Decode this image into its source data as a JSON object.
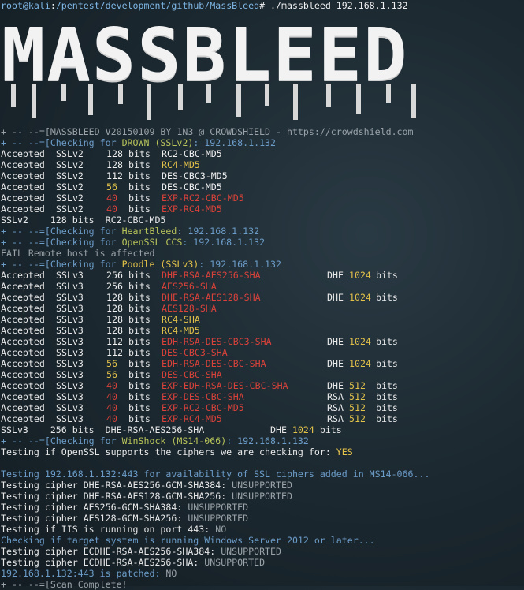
{
  "prompt": {
    "user_host": "root@kali",
    "path": "/pentest/development/github/MassBleed",
    "command": "# ./massbleed 192.168.1.132"
  },
  "banner_text": "MASSBLEED",
  "header_line": "+ -- --=[MASSBLEED V20150109 BY 1N3 @ CROWDSHIELD - https://crowdshield.com",
  "drown": {
    "check_line_prefix": "+ -- --=[Checking for ",
    "check_name": "DROWN (SSLv2)",
    "check_suffix": ": 192.168.1.132",
    "rows": [
      {
        "status": "Accepted",
        "proto": "SSLv2",
        "bits": "128",
        "cipher": "RC2-CBC-MD5",
        "bits_color": "white",
        "cipher_color": "white"
      },
      {
        "status": "Accepted",
        "proto": "SSLv2",
        "bits": "128",
        "cipher": "RC4-MD5",
        "bits_color": "white",
        "cipher_color": "yellow"
      },
      {
        "status": "Accepted",
        "proto": "SSLv2",
        "bits": "112",
        "cipher": "DES-CBC3-MD5",
        "bits_color": "white",
        "cipher_color": "white"
      },
      {
        "status": "Accepted",
        "proto": "SSLv2",
        "bits": "56",
        "cipher": "DES-CBC-MD5",
        "bits_color": "yellow",
        "cipher_color": "white"
      },
      {
        "status": "Accepted",
        "proto": "SSLv2",
        "bits": "40",
        "cipher": "EXP-RC2-CBC-MD5",
        "bits_color": "red",
        "cipher_color": "red"
      },
      {
        "status": "Accepted",
        "proto": "SSLv2",
        "bits": "40",
        "cipher": "EXP-RC4-MD5",
        "bits_color": "red",
        "cipher_color": "red"
      }
    ],
    "summary": "SSLv2    128 bits  RC2-CBC-MD5"
  },
  "heartbleed_line": {
    "prefix": "+ -- --=[Checking for ",
    "name": "HeartBleed",
    "suffix": ": 192.168.1.132"
  },
  "ccs_line": {
    "prefix": "+ -- --=[Checking for ",
    "name": "OpenSSL CCS",
    "suffix": ": 192.168.1.132"
  },
  "fail_line": "FAIL Remote host is affected",
  "poodle": {
    "prefix": "+ -- --=[Checking for ",
    "name": "Poodle (SSLv3)",
    "suffix": ": 192.168.1.132",
    "rows": [
      {
        "status": "Accepted",
        "proto": "SSLv3",
        "bits": "256",
        "cipher": "DHE-RSA-AES256-SHA",
        "bits_color": "white",
        "cipher_color": "red",
        "kx": "DHE",
        "kx_bits": "1024"
      },
      {
        "status": "Accepted",
        "proto": "SSLv3",
        "bits": "256",
        "cipher": "AES256-SHA",
        "bits_color": "white",
        "cipher_color": "red",
        "kx": "",
        "kx_bits": ""
      },
      {
        "status": "Accepted",
        "proto": "SSLv3",
        "bits": "128",
        "cipher": "DHE-RSA-AES128-SHA",
        "bits_color": "white",
        "cipher_color": "red",
        "kx": "DHE",
        "kx_bits": "1024"
      },
      {
        "status": "Accepted",
        "proto": "SSLv3",
        "bits": "128",
        "cipher": "AES128-SHA",
        "bits_color": "white",
        "cipher_color": "red",
        "kx": "",
        "kx_bits": ""
      },
      {
        "status": "Accepted",
        "proto": "SSLv3",
        "bits": "128",
        "cipher": "RC4-SHA",
        "bits_color": "white",
        "cipher_color": "yellow",
        "kx": "",
        "kx_bits": ""
      },
      {
        "status": "Accepted",
        "proto": "SSLv3",
        "bits": "128",
        "cipher": "RC4-MD5",
        "bits_color": "white",
        "cipher_color": "yellow",
        "kx": "",
        "kx_bits": ""
      },
      {
        "status": "Accepted",
        "proto": "SSLv3",
        "bits": "112",
        "cipher": "EDH-RSA-DES-CBC3-SHA",
        "bits_color": "white",
        "cipher_color": "red",
        "kx": "DHE",
        "kx_bits": "1024"
      },
      {
        "status": "Accepted",
        "proto": "SSLv3",
        "bits": "112",
        "cipher": "DES-CBC3-SHA",
        "bits_color": "white",
        "cipher_color": "red",
        "kx": "",
        "kx_bits": ""
      },
      {
        "status": "Accepted",
        "proto": "SSLv3",
        "bits": "56",
        "cipher": "EDH-RSA-DES-CBC-SHA",
        "bits_color": "yellow",
        "cipher_color": "red",
        "kx": "DHE",
        "kx_bits": "1024"
      },
      {
        "status": "Accepted",
        "proto": "SSLv3",
        "bits": "56",
        "cipher": "DES-CBC-SHA",
        "bits_color": "yellow",
        "cipher_color": "red",
        "kx": "",
        "kx_bits": ""
      },
      {
        "status": "Accepted",
        "proto": "SSLv3",
        "bits": "40",
        "cipher": "EXP-EDH-RSA-DES-CBC-SHA",
        "bits_color": "red",
        "cipher_color": "red",
        "kx": "DHE",
        "kx_bits": "512"
      },
      {
        "status": "Accepted",
        "proto": "SSLv3",
        "bits": "40",
        "cipher": "EXP-DES-CBC-SHA",
        "bits_color": "red",
        "cipher_color": "red",
        "kx": "RSA",
        "kx_bits": "512"
      },
      {
        "status": "Accepted",
        "proto": "SSLv3",
        "bits": "40",
        "cipher": "EXP-RC2-CBC-MD5",
        "bits_color": "red",
        "cipher_color": "red",
        "kx": "RSA",
        "kx_bits": "512"
      },
      {
        "status": "Accepted",
        "proto": "SSLv3",
        "bits": "40",
        "cipher": "EXP-RC4-MD5",
        "bits_color": "red",
        "cipher_color": "red",
        "kx": "RSA",
        "kx_bits": "512"
      }
    ],
    "summary_left": "SSLv3    256 bits  DHE-RSA-AES256-SHA",
    "summary_kx": "DHE",
    "summary_kx_bits": "1024",
    "summary_bits_word": "bits"
  },
  "winshock": {
    "prefix": "+ -- --=[Checking for ",
    "name": "WinShock (MS14-066)",
    "suffix": ": 192.168.1.132",
    "testing_openssl": "Testing if OpenSSL supports the ciphers we are checking for: ",
    "testing_openssl_result": "YES",
    "availability_line": "Testing 192.168.1.132:443 for availability of SSL ciphers added in MS14-066...",
    "cipher_tests": [
      {
        "label": "Testing cipher DHE-RSA-AES256-GCM-SHA384: ",
        "result": "UNSUPPORTED"
      },
      {
        "label": "Testing cipher DHE-RSA-AES128-GCM-SHA256: ",
        "result": "UNSUPPORTED"
      },
      {
        "label": "Testing cipher AES256-GCM-SHA384: ",
        "result": "UNSUPPORTED"
      },
      {
        "label": "Testing cipher AES128-GCM-SHA256: ",
        "result": "UNSUPPORTED"
      }
    ],
    "iis_line": "Testing if IIS is running on port 443: ",
    "iis_result": "NO",
    "windows_check": "Checking if target system is running Windows Server 2012 or later...",
    "ecdhe_tests": [
      {
        "label": "Testing cipher ECDHE-RSA-AES256-SHA384: ",
        "result": "UNSUPPORTED"
      },
      {
        "label": "Testing cipher ECDHE-RSA-AES256-SHA: ",
        "result": "UNSUPPORTED"
      }
    ],
    "patched_line": "192.168.1.132:443 is patched: ",
    "patched_result": "NO"
  },
  "scan_complete": "+ -- --=[Scan Complete!",
  "bits_word": "bits",
  "colors": {
    "background": "#1d2a32",
    "text": "#e8e8e8",
    "blue": "#6c9cc8",
    "yellow": "#e3c24a",
    "red": "#d9423a",
    "green": "#b9c45a",
    "gray": "#9aa2a8"
  }
}
